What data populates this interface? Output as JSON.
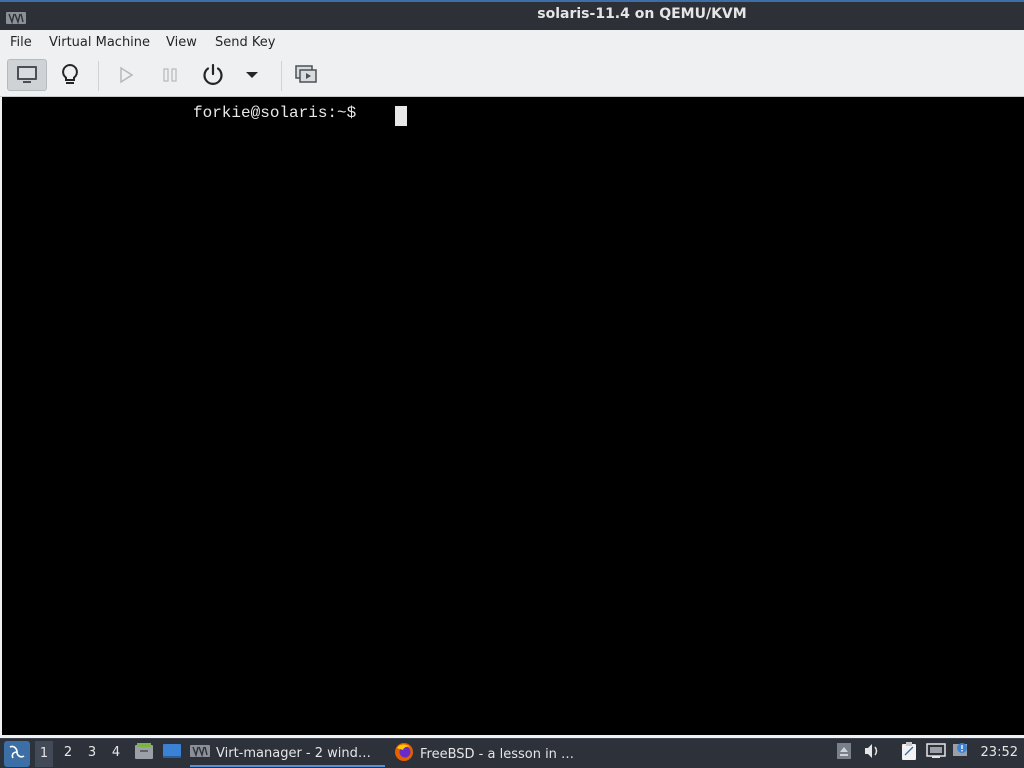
{
  "window": {
    "title": "solaris-11.4 on QEMU/KVM",
    "title_icon": "virt-manager-icon"
  },
  "menubar": {
    "items": [
      "File",
      "Virtual Machine",
      "View",
      "Send Key"
    ]
  },
  "toolbar": {
    "buttons": [
      {
        "name": "console-view-icon",
        "active": true
      },
      {
        "name": "details-lightbulb-icon",
        "active": false
      },
      {
        "name": "run-play-icon",
        "enabled": false
      },
      {
        "name": "pause-icon",
        "enabled": false
      },
      {
        "name": "power-icon",
        "enabled": true
      },
      {
        "name": "power-menu-chevron-icon",
        "enabled": true
      },
      {
        "name": "fullscreen-monitor-icon",
        "enabled": true
      }
    ]
  },
  "console": {
    "prompt": "forkie@solaris:~$ "
  },
  "taskbar": {
    "start_icon": "start-menu-icon",
    "workspaces": [
      "1",
      "2",
      "3",
      "4"
    ],
    "active_workspace": "1",
    "launchers": [
      "file-manager-icon",
      "desktop-icon"
    ],
    "apps": [
      {
        "label": "Virt-manager - 2 wind…",
        "icon": "virt-manager-icon",
        "active": true
      },
      {
        "label": "FreeBSD - a lesson in …",
        "icon": "firefox-icon",
        "active": false
      }
    ],
    "tray": [
      "eject-icon",
      "volume-icon",
      "clipboard-icon",
      "network-icon",
      "notification-icon"
    ],
    "clock": "23:52"
  },
  "colors": {
    "titlebar_bg": "#2d3036",
    "menubar_bg": "#eff0f1",
    "console_bg": "#000000",
    "taskbar_bg": "#2c313a",
    "accent": "#3b6fa6"
  }
}
